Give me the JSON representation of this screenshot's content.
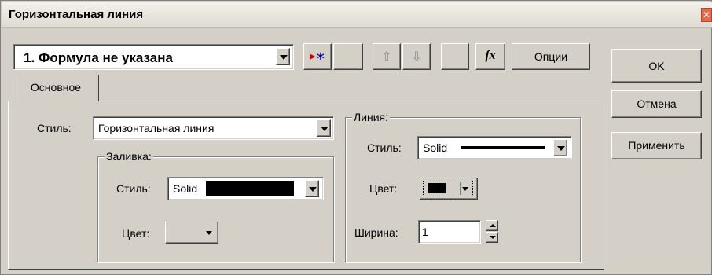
{
  "window": {
    "title": "Горизонтальная линия",
    "close_icon": "close-icon"
  },
  "toolbar": {
    "formula_value": "1.  Формула не указана",
    "new_glyph": "▸∗",
    "move_up_glyph": "⇧",
    "move_down_glyph": "⇩",
    "fx_glyph": "fx",
    "options_label": "Опции"
  },
  "buttons": {
    "ok": "OK",
    "cancel": "Отмена",
    "apply": "Применить"
  },
  "tabs": [
    {
      "label": "Основное",
      "active": true
    }
  ],
  "main": {
    "style_label": "Стиль:",
    "style_value": "Горизонтальная линия",
    "fill": {
      "legend": "Заливка:",
      "style_label": "Стиль:",
      "style_value": "Solid",
      "color_label": "Цвет:"
    },
    "line": {
      "legend": "Линия:",
      "style_label": "Стиль:",
      "style_value": "Solid",
      "color_label": "Цвет:",
      "color_value": "#000000",
      "width_label": "Ширина:",
      "width_value": "1"
    }
  },
  "colors": {
    "dialog_bg": "#d4d0c8",
    "new_arrow": "#c00000",
    "new_star": "#0000a0",
    "close_bg": "#e86a4a"
  }
}
